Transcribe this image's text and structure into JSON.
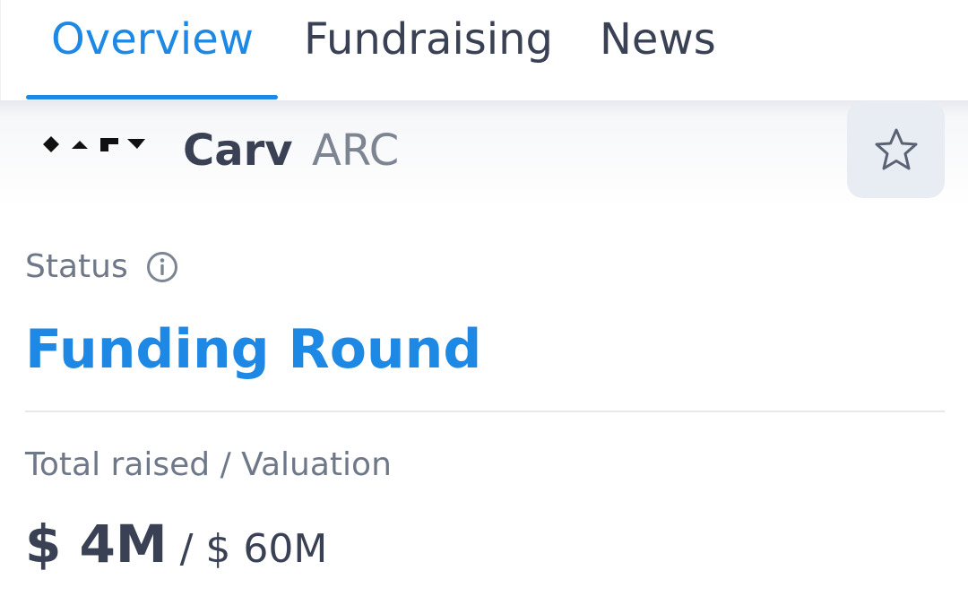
{
  "tabs": {
    "overview": "Overview",
    "fundraising": "Fundraising",
    "news": "News"
  },
  "coin": {
    "name": "Carv",
    "symbol": "ARC",
    "logo_text": "CARV"
  },
  "status": {
    "label": "Status",
    "value": "Funding Round"
  },
  "funding": {
    "label": "Total raised / Valuation",
    "raised": "$ 4M",
    "separator": " / ",
    "valuation": "$ 60M"
  },
  "icons": {
    "info": "info-icon",
    "star": "star-icon"
  },
  "colors": {
    "accent": "#1e88e5",
    "text": "#3a4154",
    "muted": "#6f7888"
  }
}
